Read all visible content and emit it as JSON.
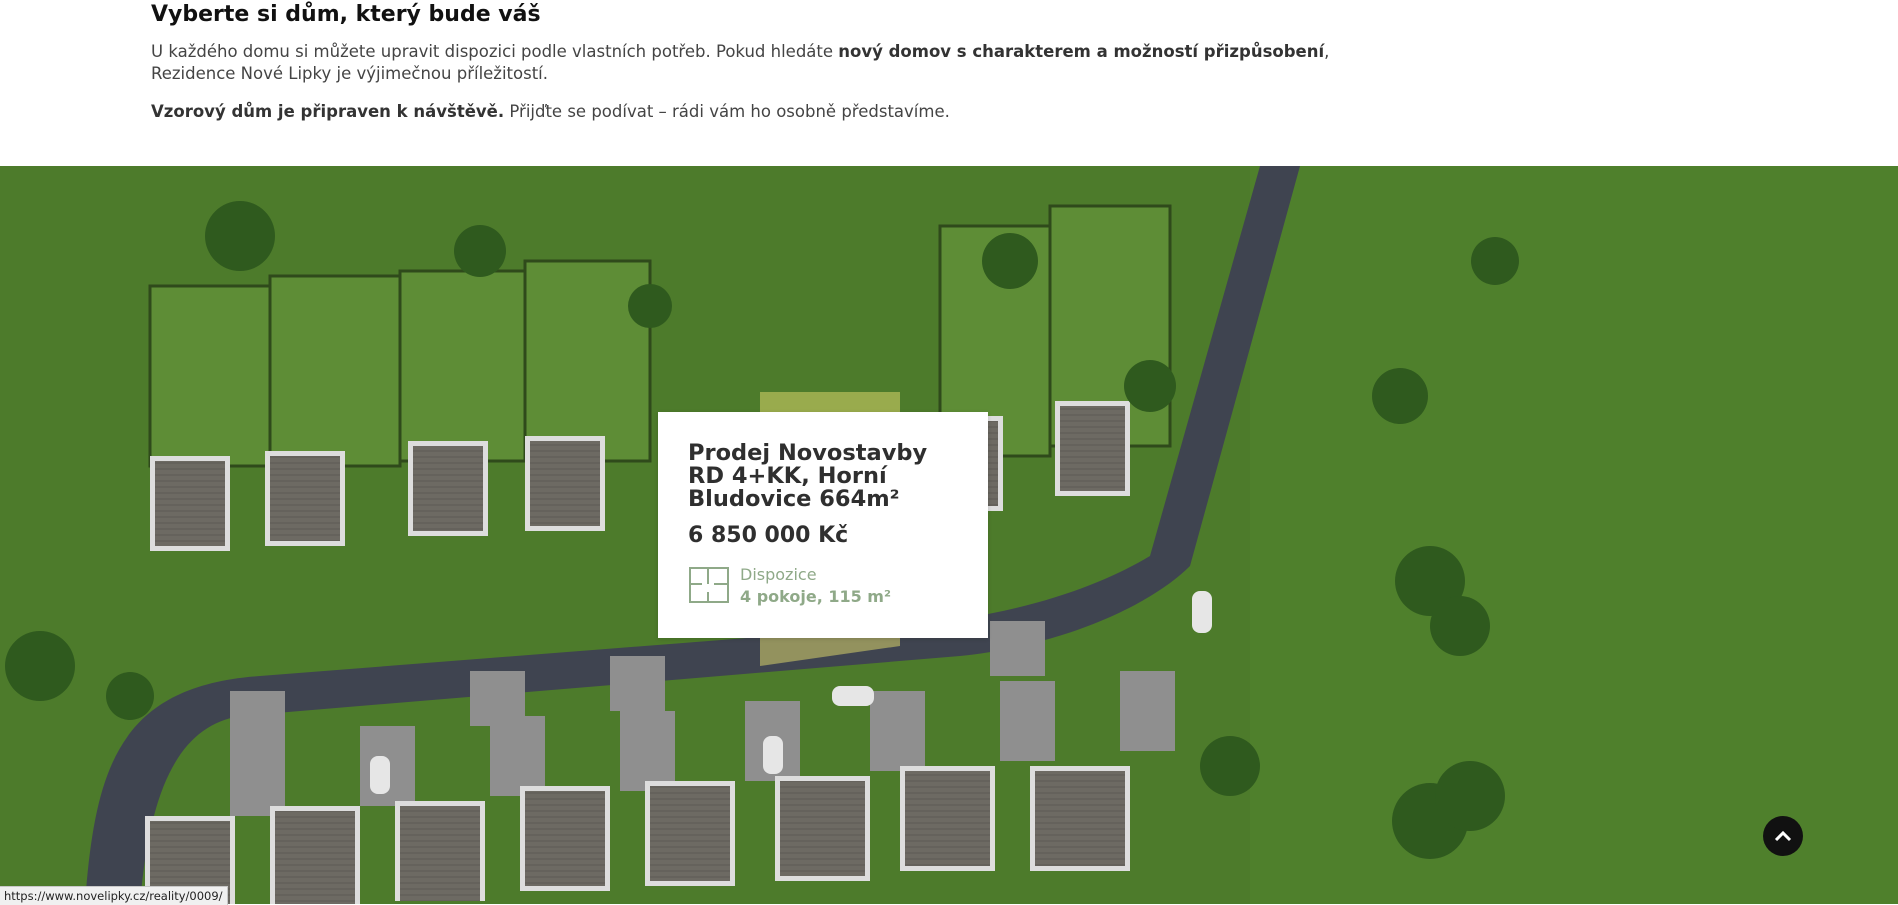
{
  "intro": {
    "heading": "Vyberte si dům, který bude váš",
    "p1_part1": "U každého domu si můžete upravit dispozici podle vlastních potřeb. Pokud hledáte ",
    "p1_bold": "nový domov s charakterem a možností přizpůsobení",
    "p1_part2": ", Rezidence Nové Lipky je výjimečnou příležitostí.",
    "p2_bold": "Vzorový dům je připraven k návštěvě.",
    "p2_rest": " Přijďte se podívat – rádi vám ho osobně představíme."
  },
  "card": {
    "title": "Prodej Novostavby RD 4+KK, Horní Bludovice 664m²",
    "price": "6 850 000 Kč",
    "disp_label": "Dispozice",
    "disp_value": "4 pokoje, 115 m²",
    "icon": "floorplan-icon"
  },
  "scroll_top": {
    "icon": "chevron-up-icon"
  },
  "status_bar": {
    "url": "https://www.novelipky.cz/reality/0009/"
  },
  "colors": {
    "grass": "#4c7a2a",
    "road": "#3f4450",
    "highlight": "#d8d36a",
    "card_accent": "#8fa988"
  }
}
